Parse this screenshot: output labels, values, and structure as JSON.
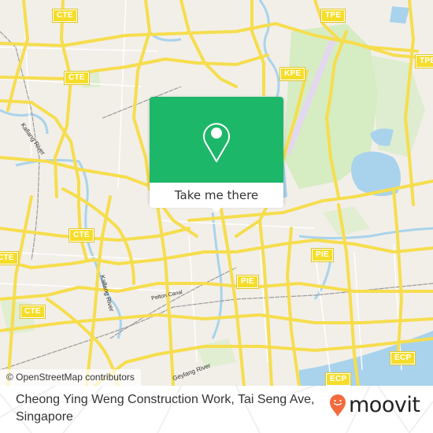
{
  "map": {
    "attribution": "© OpenStreetMap contributors",
    "colors": {
      "land": "#f2efe9",
      "road": "#f6dd4e",
      "water": "#a9d3ec",
      "park": "#d6ecc3",
      "rail": "#999999",
      "accent": "#1db76a"
    },
    "shields": [
      {
        "label": "CTE",
        "name": "cte-shield-1"
      },
      {
        "label": "CTE",
        "name": "cte-shield-2"
      },
      {
        "label": "CTE",
        "name": "cte-shield-3"
      },
      {
        "label": "CTE",
        "name": "cte-shield-4"
      },
      {
        "label": "CTE",
        "name": "cte-shield-5"
      },
      {
        "label": "TPE",
        "name": "tpe-shield-1"
      },
      {
        "label": "TPE",
        "name": "tpe-shield-2"
      },
      {
        "label": "KPE",
        "name": "kpe-shield"
      },
      {
        "label": "PIE",
        "name": "pie-shield-1"
      },
      {
        "label": "PIE",
        "name": "pie-shield-2"
      },
      {
        "label": "ECP",
        "name": "ecp-shield-1"
      },
      {
        "label": "ECP",
        "name": "ecp-shield-2"
      }
    ],
    "labels": {
      "kallang_river_1": "Kallang River",
      "kallang_river_2": "Kallang River",
      "geylang_river": "Geylang River",
      "pelton_canal": "Pelton Canal"
    }
  },
  "popup": {
    "icon": "map-pin-icon",
    "button_label": "Take me there"
  },
  "footer": {
    "title": "Cheong Ying Weng Construction Work, Tai Seng Ave, Singapore",
    "brand": "moovit",
    "brand_icon": "moovit-smile-pin-icon"
  }
}
